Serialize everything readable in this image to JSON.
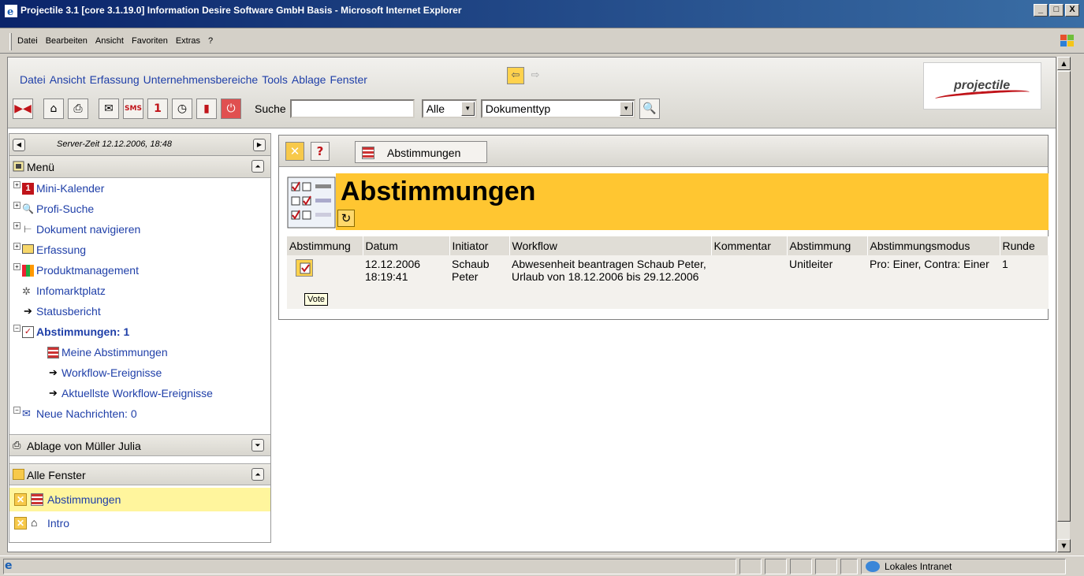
{
  "window": {
    "title": "Projectile 3.1 [core 3.1.19.0] Information Desire Software GmbH Basis - Microsoft Internet Explorer",
    "buttons": [
      "_",
      "□",
      "X"
    ]
  },
  "ie_menu": [
    "Datei",
    "Bearbeiten",
    "Ansicht",
    "Favoriten",
    "Extras",
    "?"
  ],
  "app_menu": [
    "Datei",
    "Ansicht",
    "Erfassung",
    "Unternehmensbereiche",
    "Tools",
    "Ablage",
    "Fenster"
  ],
  "logo": {
    "text": "projectile",
    "accent": "#c0141a"
  },
  "toolbar": {
    "search_label": "Suche",
    "search_value": "",
    "scope_select": "Alle",
    "doctype_select": "Dokumenttyp"
  },
  "sidebar": {
    "server_time": "Server-Zeit 12.12.2006, 18:48",
    "menu_title": "Menü",
    "tree": [
      {
        "label": "Mini-Kalender",
        "icon": "calendar-icon",
        "expand": "+"
      },
      {
        "label": "Profi-Suche",
        "icon": "magnifier-icon",
        "expand": "+"
      },
      {
        "label": "Dokument navigieren",
        "icon": "tree-icon",
        "expand": "+"
      },
      {
        "label": "Erfassung",
        "icon": "folder-icon",
        "expand": "+"
      },
      {
        "label": "Produktmanagement",
        "icon": "products-icon",
        "expand": "+"
      },
      {
        "label": "Infomarktplatz",
        "icon": "marketplace-icon",
        "expand": ""
      },
      {
        "label": "Statusbericht",
        "icon": "arrow-icon",
        "expand": ""
      },
      {
        "label": "Abstimmungen: 1",
        "icon": "vote-icon",
        "expand": "−"
      },
      {
        "label": "Meine Abstimmungen",
        "icon": "list-icon",
        "expand": ""
      },
      {
        "label": "Workflow-Ereignisse",
        "icon": "arrow-icon",
        "expand": ""
      },
      {
        "label": "Aktuellste Workflow-Ereignisse",
        "icon": "arrow-icon",
        "expand": ""
      },
      {
        "label": "Neue Nachrichten: 0",
        "icon": "mail-icon",
        "expand": "−"
      }
    ],
    "ablage_title": "Ablage von Müller Julia",
    "windows_title": "Alle Fenster",
    "windows": [
      {
        "label": "Abstimmungen",
        "active": true
      },
      {
        "label": "Intro",
        "active": false
      }
    ]
  },
  "content": {
    "tab_label": "Abstimmungen",
    "heading": "Abstimmungen",
    "table": {
      "headers": [
        "Abstimmung",
        "Datum",
        "Initiator",
        "Workflow",
        "Kommentar",
        "Abstimmung",
        "Abstimmungsmodus",
        "Runde"
      ],
      "rows": [
        {
          "datum": "12.12.2006 18:19:41",
          "initiator": "Schaub Peter",
          "workflow": "Abwesenheit beantragen Schaub Peter, Urlaub von 18.12.2006 bis 29.12.2006",
          "kommentar": "",
          "abstimmung": "Unitleiter",
          "modus": "Pro: Einer, Contra: Einer",
          "runde": "1"
        }
      ]
    },
    "tooltip": "Vote"
  },
  "statusbar": {
    "zone": "Lokales Intranet"
  },
  "colors": {
    "banner": "#ffc631",
    "link": "#1f3fa8",
    "active_window": "#fff59d"
  }
}
